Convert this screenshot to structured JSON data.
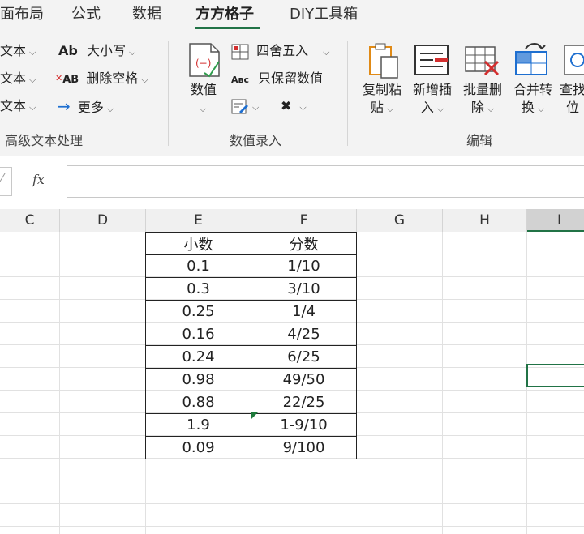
{
  "tabs": [
    {
      "label": "面布局"
    },
    {
      "label": "公式"
    },
    {
      "label": "数据"
    },
    {
      "label": "方方格子",
      "active": true
    },
    {
      "label": "DIY工具箱"
    }
  ],
  "ribbon": {
    "group_text": {
      "label": "高级文本处理",
      "left_items": [
        "文本",
        "文本",
        "文本"
      ],
      "case_label": "大小写",
      "delete_space_label": "删除空格",
      "more_label": "更多"
    },
    "group_numeric": {
      "label": "数值录入",
      "value_label": "数值",
      "round_label": "四舍五入",
      "keep_value_label": "只保留数值"
    },
    "group_edit": {
      "label": "编辑",
      "buttons": [
        {
          "line1": "复制粘",
          "line2": "贴"
        },
        {
          "line1": "新增插",
          "line2": "入"
        },
        {
          "line1": "批量删",
          "line2": "除"
        },
        {
          "line1": "合并转",
          "line2": "换"
        },
        {
          "line1": "查找",
          "line2": "位"
        }
      ]
    }
  },
  "formula_bar": {
    "fx_label": "fx",
    "value": ""
  },
  "columns": [
    "C",
    "D",
    "E",
    "F",
    "G",
    "H",
    "I"
  ],
  "selected_column": "I",
  "table": {
    "headers": [
      "小数",
      "分数"
    ],
    "rows": [
      [
        "0.1",
        "1/10"
      ],
      [
        "0.3",
        "3/10"
      ],
      [
        "0.25",
        "1/4"
      ],
      [
        "0.16",
        "4/25"
      ],
      [
        "0.24",
        "6/25"
      ],
      [
        "0.98",
        "49/50"
      ],
      [
        "0.88",
        "22/25"
      ],
      [
        "1.9",
        "1-9/10"
      ],
      [
        "0.09",
        "9/100"
      ]
    ]
  },
  "colors": {
    "accent": "#217346",
    "ribbon_bg": "#f3f3f3",
    "error_marker": "#1e7a3b"
  }
}
